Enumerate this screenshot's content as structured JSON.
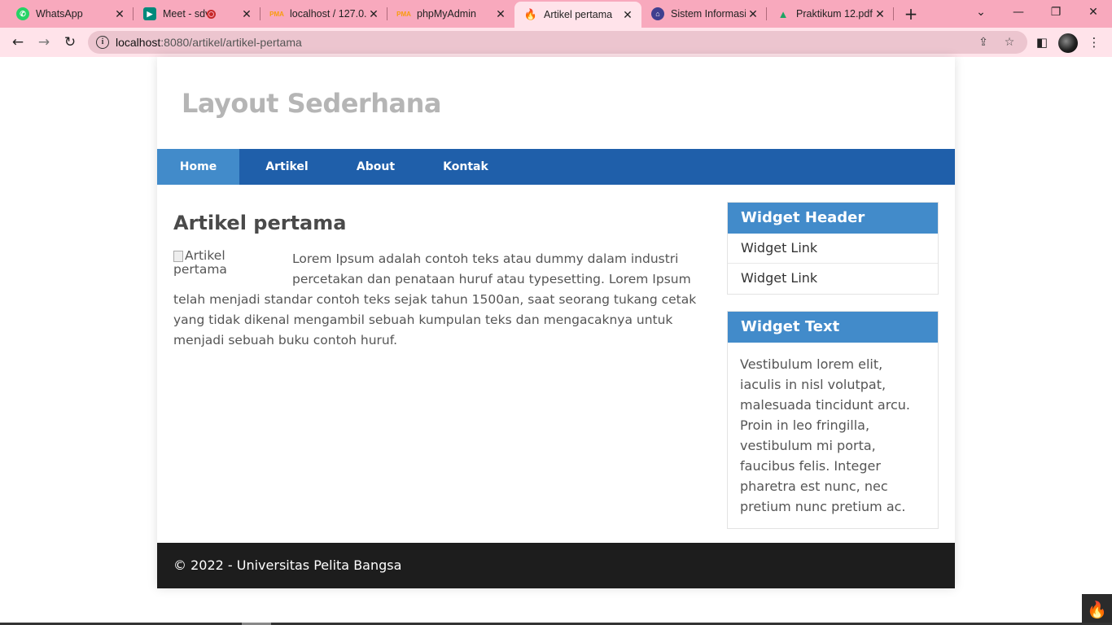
{
  "browser": {
    "tabs": [
      {
        "title": "WhatsApp",
        "icon": "whatsapp-icon",
        "color": "#25d366",
        "active": false
      },
      {
        "title": "Meet - sdv-a",
        "icon": "google-meet-icon",
        "color": "#00897b",
        "active": false,
        "recording": true
      },
      {
        "title": "localhost / 127.0.",
        "icon": "phpmyadmin-icon",
        "color": "#f89c0e",
        "active": false
      },
      {
        "title": "phpMyAdmin",
        "icon": "phpmyadmin-icon",
        "color": "#f89c0e",
        "active": false
      },
      {
        "title": "Artikel pertama",
        "icon": "codeigniter-icon",
        "color": "#dd4814",
        "active": true
      },
      {
        "title": "Sistem Informasi",
        "icon": "university-icon",
        "color": "#3f3f8f",
        "active": false
      },
      {
        "title": "Praktikum 12.pdf",
        "icon": "google-drive-icon",
        "color": "#1fa463",
        "active": false
      }
    ],
    "address": {
      "host": "localhost",
      "rest": ":8080/artikel/artikel-pertama"
    }
  },
  "page": {
    "site_title": "Layout Sederhana",
    "nav": [
      "Home",
      "Artikel",
      "About",
      "Kontak"
    ],
    "article": {
      "title": "Artikel pertama",
      "image_alt": "Artikel pertama",
      "body": "Lorem Ipsum adalah contoh teks atau dummy dalam industri percetakan dan penataan huruf atau typesetting. Lorem Ipsum telah menjadi standar contoh teks sejak tahun 1500an, saat seorang tukang cetak yang tidak dikenal mengambil sebuah kumpulan teks dan mengacaknya untuk menjadi sebuah buku contoh huruf."
    },
    "widget_links": {
      "header": "Widget Header",
      "links": [
        "Widget Link",
        "Widget Link"
      ]
    },
    "widget_text": {
      "header": "Widget Text",
      "text": "Vestibulum lorem elit, iaculis in nisl volutpat, malesuada tincidunt arcu. Proin in leo fringilla, vestibulum mi porta, faucibus felis. Integer pharetra est nunc, nec pretium nunc pretium ac."
    },
    "footer": "© 2022 - Universitas Pelita Bangsa"
  },
  "colors": {
    "tabbar": "#f8a9bd",
    "toolbar": "#ffe3ea",
    "nav": "#1f5faa",
    "nav_active": "#428bca",
    "widget_header": "#428bca",
    "footer": "#1d1d1d"
  }
}
